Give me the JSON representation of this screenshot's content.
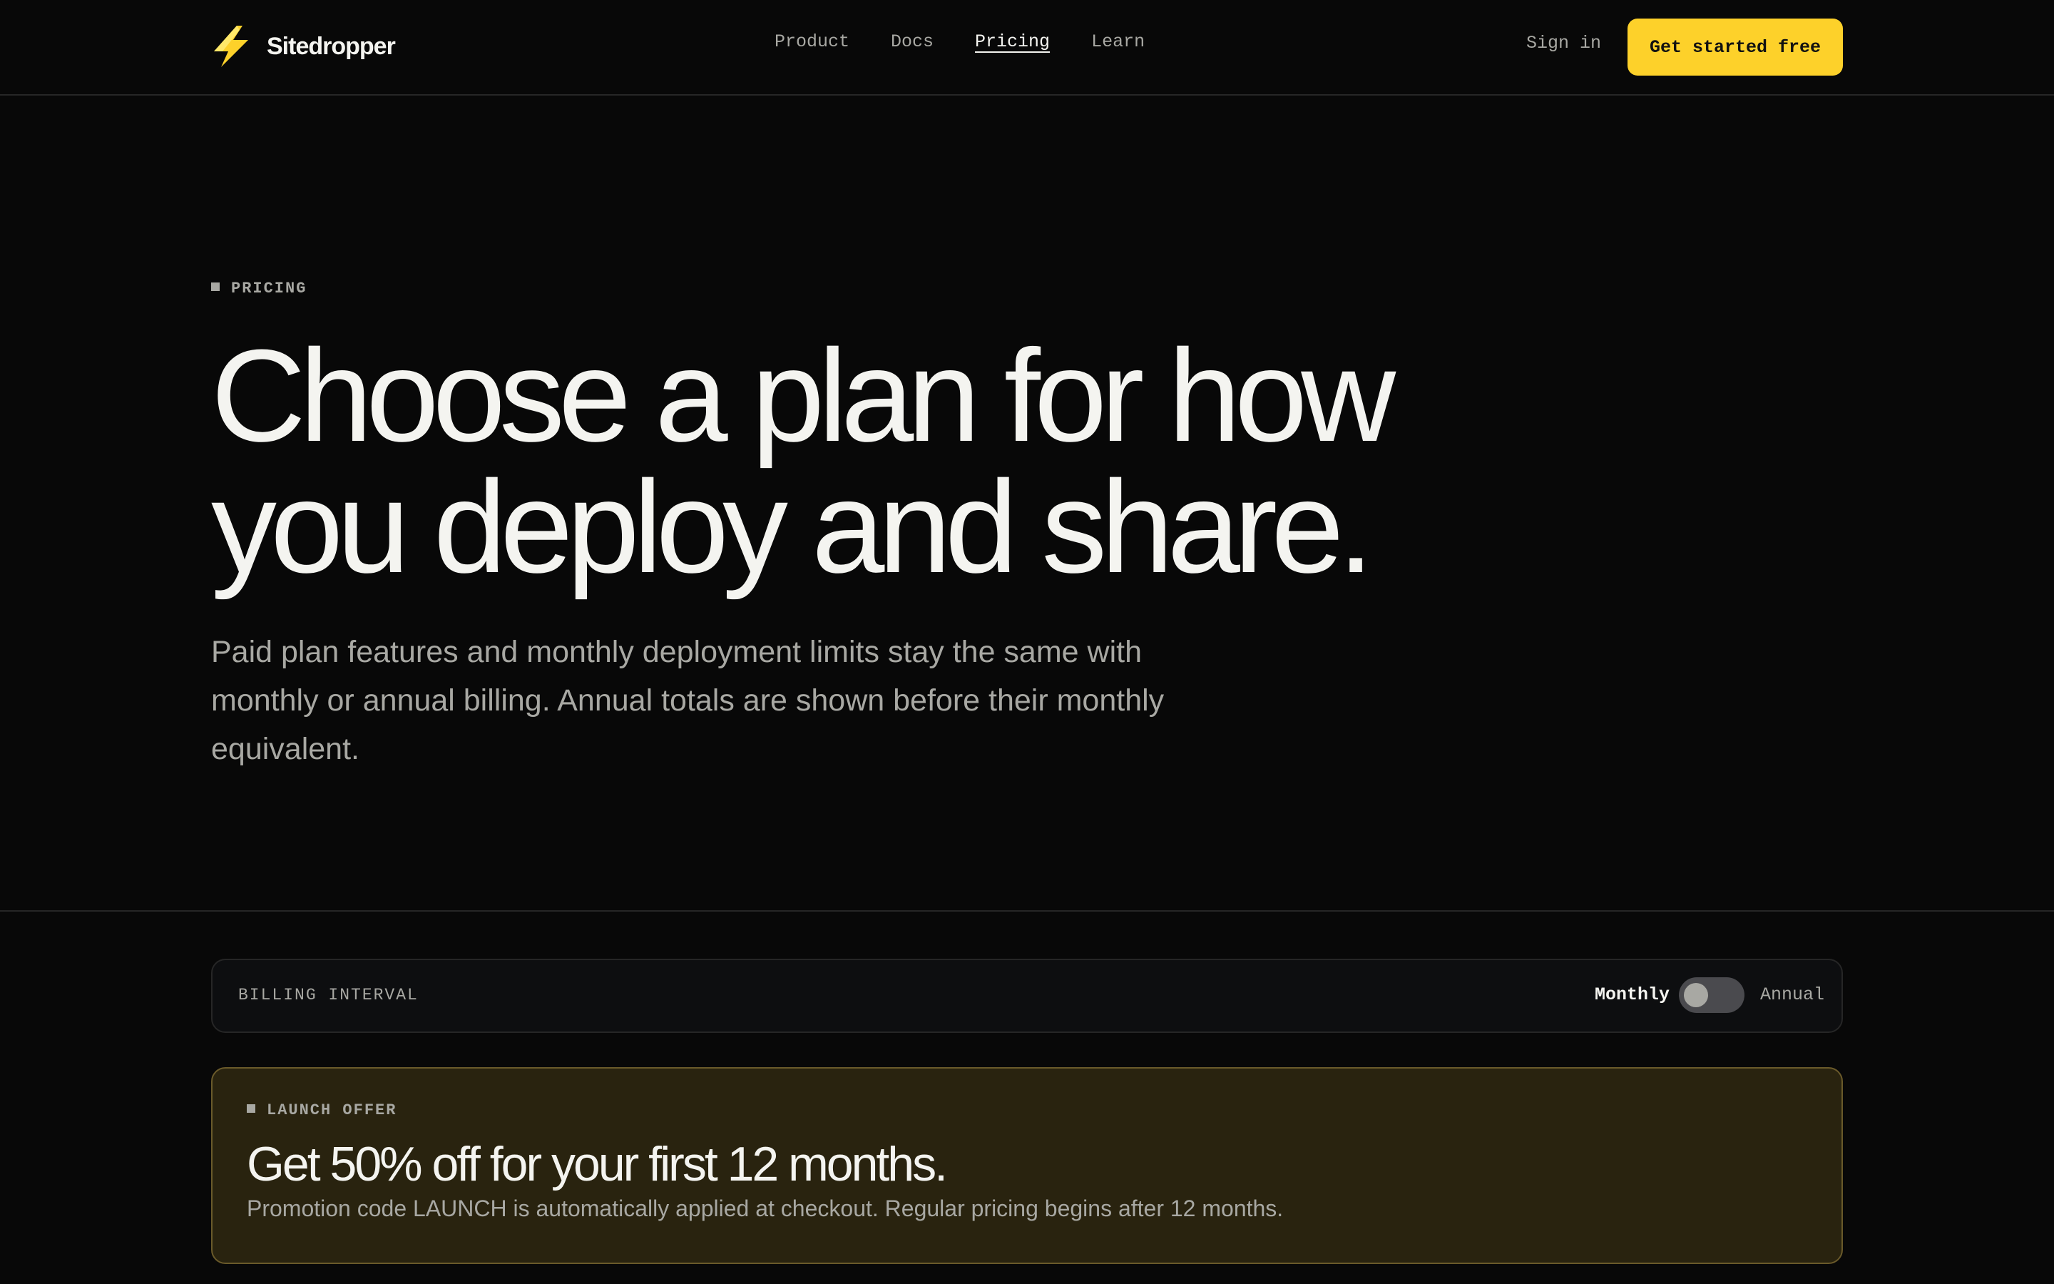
{
  "colors": {
    "background": "#080808",
    "accent": "#fdd12a",
    "text": "#f4f4f0",
    "muted": "#a8a8a3",
    "offer_background": "#29230f"
  },
  "nav": {
    "brand_name": "Sitedropper",
    "brand_icon": "lightning-bolt-icon",
    "links": [
      {
        "label": "Product",
        "active": false
      },
      {
        "label": "Docs",
        "active": false
      },
      {
        "label": "Pricing",
        "active": true
      },
      {
        "label": "Learn",
        "active": false
      }
    ],
    "sign_in": "Sign in",
    "cta": "Get started free"
  },
  "hero": {
    "eyebrow": "PRICING",
    "title": "Choose a plan for how you deploy and share.",
    "subtitle": "Paid plan features and monthly deployment limits stay the same with monthly or annual billing. Annual totals are shown before their monthly equivalent."
  },
  "billing": {
    "label": "BILLING INTERVAL",
    "option_monthly": "Monthly",
    "option_annual": "Annual",
    "selected": "Monthly"
  },
  "offer": {
    "eyebrow": "LAUNCH OFFER",
    "title": "Get 50% off for your first 12 months.",
    "description": "Promotion code LAUNCH is automatically applied at checkout. Regular pricing begins after 12 months."
  }
}
